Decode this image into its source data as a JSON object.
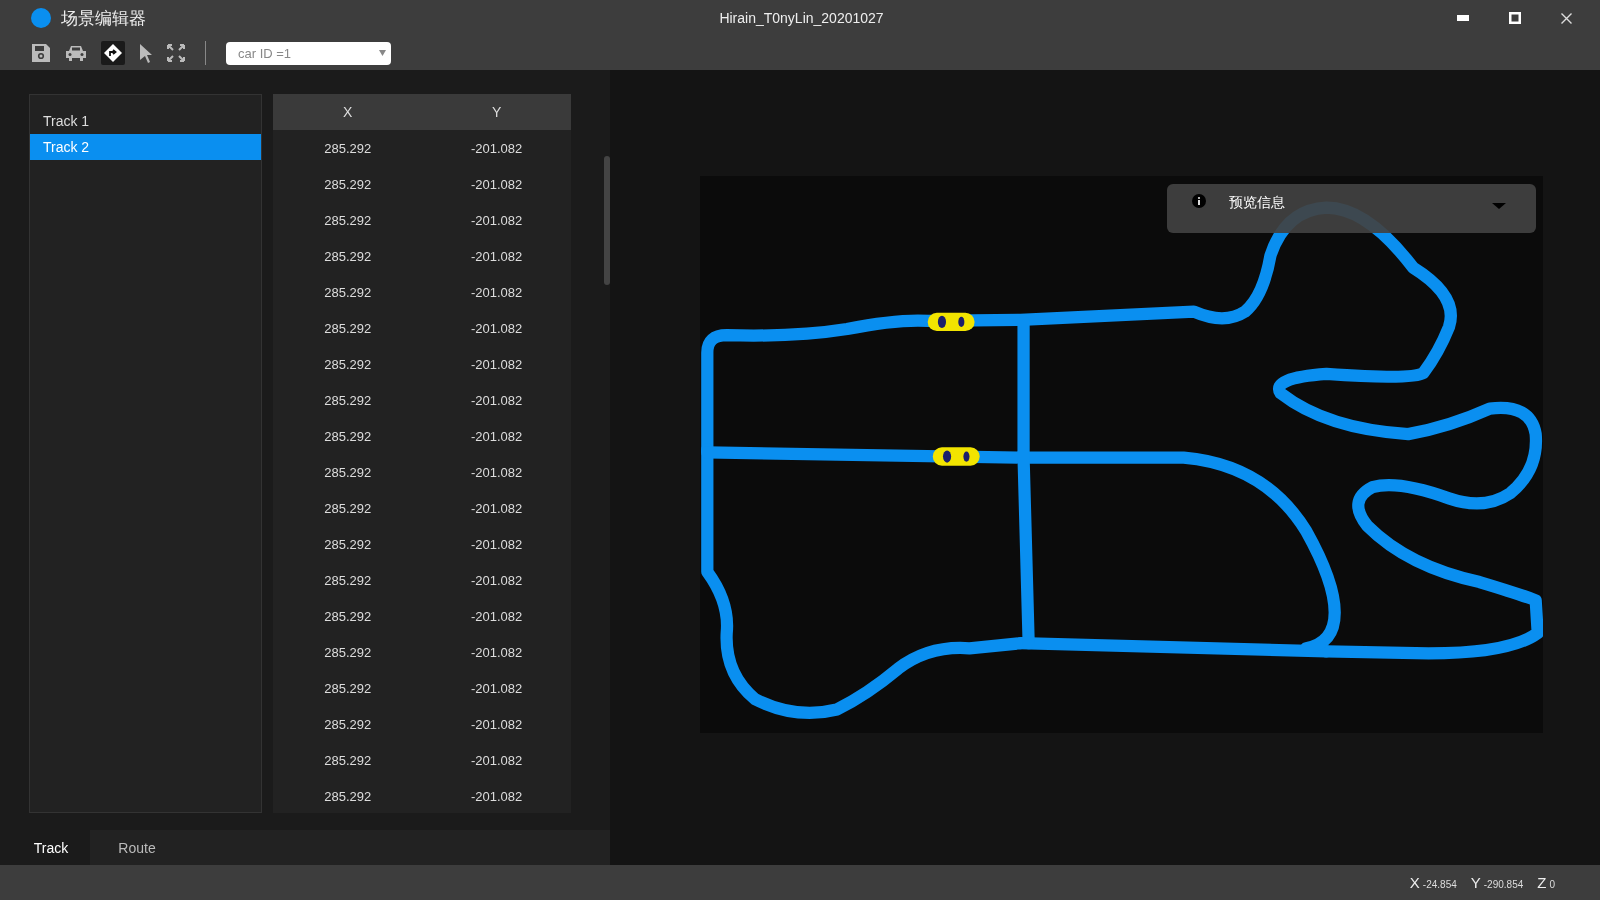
{
  "window": {
    "app_name": "场景编辑器",
    "title": "Hirain_T0nyLin_20201027"
  },
  "toolbar": {
    "car_select": {
      "value": "car ID =1"
    }
  },
  "tracks": [
    {
      "label": "Track 1",
      "selected": false
    },
    {
      "label": "Track 2",
      "selected": true
    }
  ],
  "table": {
    "columns": [
      "X",
      "Y"
    ],
    "rows": [
      [
        "285.292",
        "-201.082"
      ],
      [
        "285.292",
        "-201.082"
      ],
      [
        "285.292",
        "-201.082"
      ],
      [
        "285.292",
        "-201.082"
      ],
      [
        "285.292",
        "-201.082"
      ],
      [
        "285.292",
        "-201.082"
      ],
      [
        "285.292",
        "-201.082"
      ],
      [
        "285.292",
        "-201.082"
      ],
      [
        "285.292",
        "-201.082"
      ],
      [
        "285.292",
        "-201.082"
      ],
      [
        "285.292",
        "-201.082"
      ],
      [
        "285.292",
        "-201.082"
      ],
      [
        "285.292",
        "-201.082"
      ],
      [
        "285.292",
        "-201.082"
      ],
      [
        "285.292",
        "-201.082"
      ],
      [
        "285.292",
        "-201.082"
      ],
      [
        "285.292",
        "-201.082"
      ],
      [
        "285.292",
        "-201.082"
      ],
      [
        "285.292",
        "-201.082"
      ]
    ]
  },
  "tabs": [
    {
      "label": "Track",
      "selected": true
    },
    {
      "label": "Route",
      "selected": false
    }
  ],
  "preview_panel": {
    "title": "预览信息"
  },
  "status_bar": [
    {
      "label": "X",
      "value": "-24.854"
    },
    {
      "label": "Y",
      "value": "-290.854"
    },
    {
      "label": "Z",
      "value": "0"
    }
  ]
}
